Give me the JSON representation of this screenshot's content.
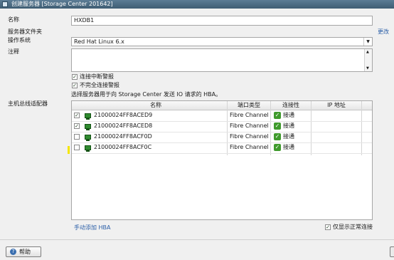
{
  "window": {
    "title": "创建服务器 [Storage Center 201642]"
  },
  "form": {
    "name_label": "名称",
    "name_value": "HXDB1",
    "folder_label": "服务器文件夹",
    "more_link": "更改",
    "os_label": "操作系统",
    "os_value": "Red Hat Linux 6.x",
    "notes_label": "注释",
    "alert_disconnect": {
      "label": "连接中断警报",
      "checked": true
    },
    "alert_partial": {
      "label": "不完全连接警报",
      "checked": true
    },
    "hba_hint": "选择服务器用于向 Storage Center 发送 IO 请求的 HBA。",
    "hba_label": "主机总线适配器"
  },
  "table": {
    "columns": [
      "名称",
      "端口类型",
      "连接性",
      "IP 地址"
    ],
    "rows": [
      {
        "checked": true,
        "name": "21000024FF8ACED9",
        "port_type": "Fibre Channel",
        "connectivity": "接通",
        "ip": ""
      },
      {
        "checked": true,
        "name": "21000024FF8ACED8",
        "port_type": "Fibre Channel",
        "connectivity": "接通",
        "ip": ""
      },
      {
        "checked": false,
        "name": "21000024FF8ACF0D",
        "port_type": "Fibre Channel",
        "connectivity": "接通",
        "ip": ""
      },
      {
        "checked": false,
        "name": "21000024FF8ACF0C",
        "port_type": "Fibre Channel",
        "connectivity": "接通",
        "ip": ""
      }
    ]
  },
  "footer": {
    "add_hba_link": "手动添加 HBA",
    "show_normal": {
      "label": "仅显示正常连接",
      "checked": true
    },
    "help_button": "帮助"
  },
  "icons": {
    "window": "server-icon",
    "hba": "hba-card-icon",
    "connected": "check-icon",
    "help": "help-icon"
  },
  "colors": {
    "titlebar": "#4a6a82",
    "link": "#2b5fa8",
    "connected": "#3f9a2c"
  }
}
